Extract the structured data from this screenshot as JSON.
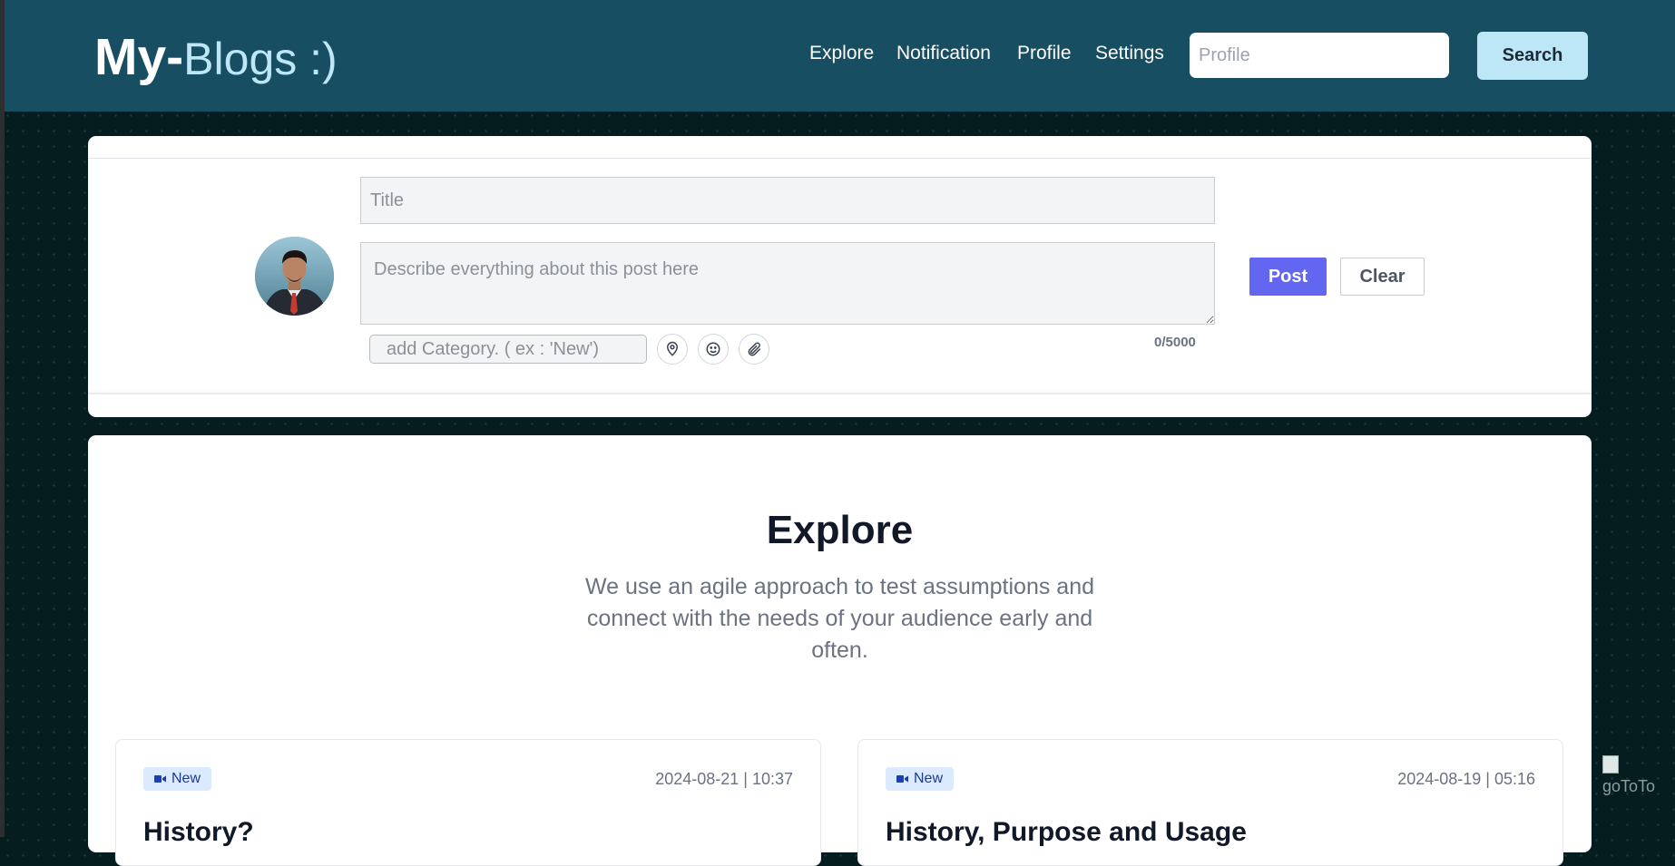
{
  "header": {
    "logo_bold": "My-",
    "logo_light": "Blogs :)",
    "nav": [
      "Explore",
      "Notification",
      "Profile",
      "Settings"
    ],
    "search_placeholder": "Profile",
    "search_button": "Search"
  },
  "composer": {
    "title_placeholder": "Title",
    "description_placeholder": "Describe everything about this post here",
    "category_placeholder": "add Category. ( ex : 'New')",
    "char_count": "0/5000",
    "post_button": "Post",
    "clear_button": "Clear",
    "tool_icons": [
      "location-pin-icon",
      "smiley-icon",
      "paperclip-icon"
    ]
  },
  "explore": {
    "heading": "Explore",
    "subtitle": "We use an agile approach to test assumptions and connect with the needs of your audience early and often.",
    "posts": [
      {
        "badge": "New",
        "date": "2024-08-21 | 10:37",
        "title": "History?"
      },
      {
        "badge": "New",
        "date": "2024-08-19 | 05:16",
        "title": "History, Purpose and Usage"
      }
    ]
  },
  "goto_alt": "goToTo",
  "colors": {
    "navbar": "#174e62",
    "accent_light": "#bde6f7",
    "post_button": "#6366f1",
    "badge_bg": "#dbeafe"
  }
}
